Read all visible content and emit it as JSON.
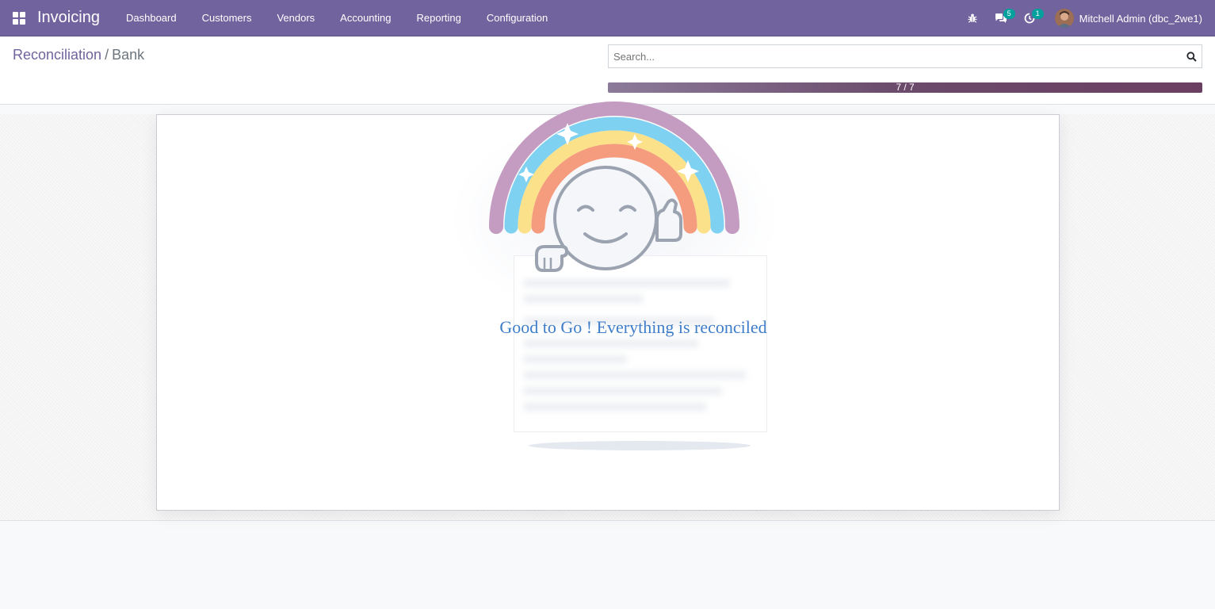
{
  "navbar": {
    "brand": "Invoicing",
    "menu": [
      "Dashboard",
      "Customers",
      "Vendors",
      "Accounting",
      "Reporting",
      "Configuration"
    ],
    "messages_count": "5",
    "activities_count": "1",
    "user_name": "Mitchell Admin (dbc_2we1)",
    "icons": {
      "apps": "apps-grid-icon",
      "debug": "bug-icon",
      "messages": "chat-bubbles-icon",
      "activities": "clock-icon"
    }
  },
  "breadcrumb": {
    "parent": "Reconciliation",
    "separator": "/",
    "current": "Bank"
  },
  "search": {
    "placeholder": "Search..."
  },
  "progress": {
    "label": "7 / 7",
    "done": 7,
    "total": 7
  },
  "message": "Good to Go ! Everything is reconciled",
  "colors": {
    "navbar": "#71639e",
    "brand_purple": "#71639e",
    "message_blue": "#3e7dc9",
    "badge": "#00a09d"
  }
}
